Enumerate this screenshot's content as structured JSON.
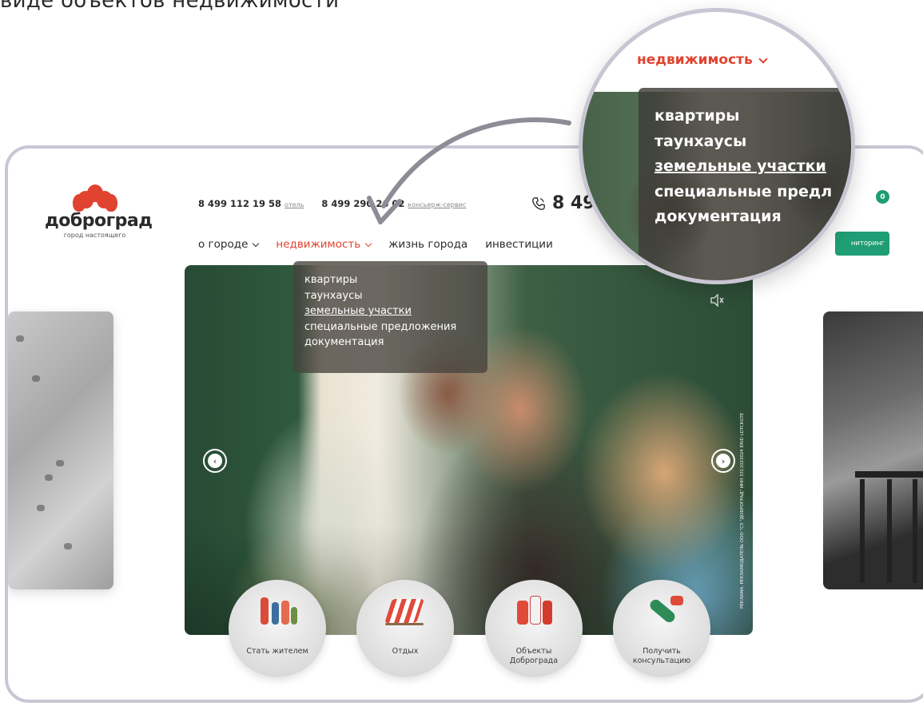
{
  "caption": "виде объектов недвижимости",
  "logo": {
    "name": "доброград",
    "tagline": "город настоящего"
  },
  "phones": [
    {
      "number": "8 499 112 19 58",
      "label": "отель"
    },
    {
      "number": "8 499 290 26 02",
      "label": "консьерж-сервис"
    }
  ],
  "main_phone": "8 49",
  "nav": {
    "items": [
      {
        "label": "о городе",
        "has_chevron": true,
        "active": false
      },
      {
        "label": "недвижимость",
        "has_chevron": true,
        "active": true
      },
      {
        "label": "жизнь города",
        "has_chevron": false,
        "active": false
      },
      {
        "label": "инвестиции",
        "has_chevron": false,
        "active": false
      }
    ]
  },
  "dropdown": {
    "items": [
      "квартиры",
      "таунхаусы",
      "земельные участки",
      "специальные предложения",
      "документация"
    ],
    "underlined_index": 2
  },
  "monitoring_button": "ниторинг",
  "notification_count": "0",
  "hero": {
    "legal_text": "РЕКЛАМА. РЕКЛАМОДАТЕЛЬ ООО \"СЗ \"ДОБРОГРАД\" ИНН 3311023024 ERID LDTCKGTE"
  },
  "quick_links": [
    {
      "label": "Стать жителем"
    },
    {
      "label": "Отдых"
    },
    {
      "label": "Объекты\nДоброграда"
    },
    {
      "label": "Получить\nконсультацию"
    }
  ],
  "magnifier": {
    "nav_label": "недвижимость",
    "items": [
      "квартиры",
      "таунхаусы",
      "земельные участки",
      "специальные предл",
      "документация"
    ],
    "underlined_index": 2
  },
  "colors": {
    "accent_red": "#e0432f",
    "accent_green": "#1f9d74",
    "frame": "#c9c6d3"
  }
}
